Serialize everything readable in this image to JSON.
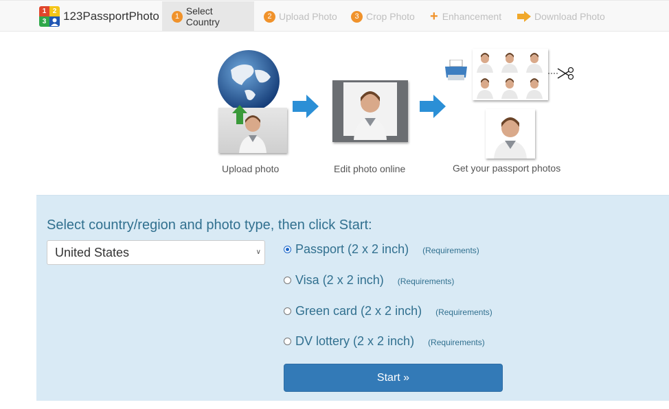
{
  "nav": {
    "brand": "123PassportPhoto",
    "logo_digits": [
      "1",
      "2",
      "3"
    ],
    "steps": [
      {
        "number": "1",
        "label": "Select Country",
        "active": true
      },
      {
        "number": "2",
        "label": "Upload Photo",
        "active": false
      },
      {
        "number": "3",
        "label": "Crop Photo",
        "active": false
      },
      {
        "icon": "plus-icon",
        "label": "Enhancement",
        "active": false
      },
      {
        "icon": "arrow-right-icon",
        "label": "Download Photo",
        "active": false
      }
    ]
  },
  "hero": {
    "captions": [
      "Upload photo",
      "Edit photo online",
      "Get your passport photos"
    ]
  },
  "form": {
    "heading": "Select country/region and photo type, then click Start:",
    "country": "United States",
    "photo_types": [
      {
        "label": "Passport (2 x 2 inch)",
        "requirements": "(Requirements)",
        "checked": true
      },
      {
        "label": "Visa (2 x 2 inch)",
        "requirements": "(Requirements)",
        "checked": false
      },
      {
        "label": "Green card (2 x 2 inch)",
        "requirements": "(Requirements)",
        "checked": false
      },
      {
        "label": "DV lottery (2 x 2 inch)",
        "requirements": "(Requirements)",
        "checked": false
      }
    ],
    "start_label": "Start »"
  },
  "colors": {
    "accent_orange": "#f0922b",
    "panel_bg": "#d9eaf5",
    "text_blue": "#31708f",
    "button_blue": "#337ab7"
  }
}
